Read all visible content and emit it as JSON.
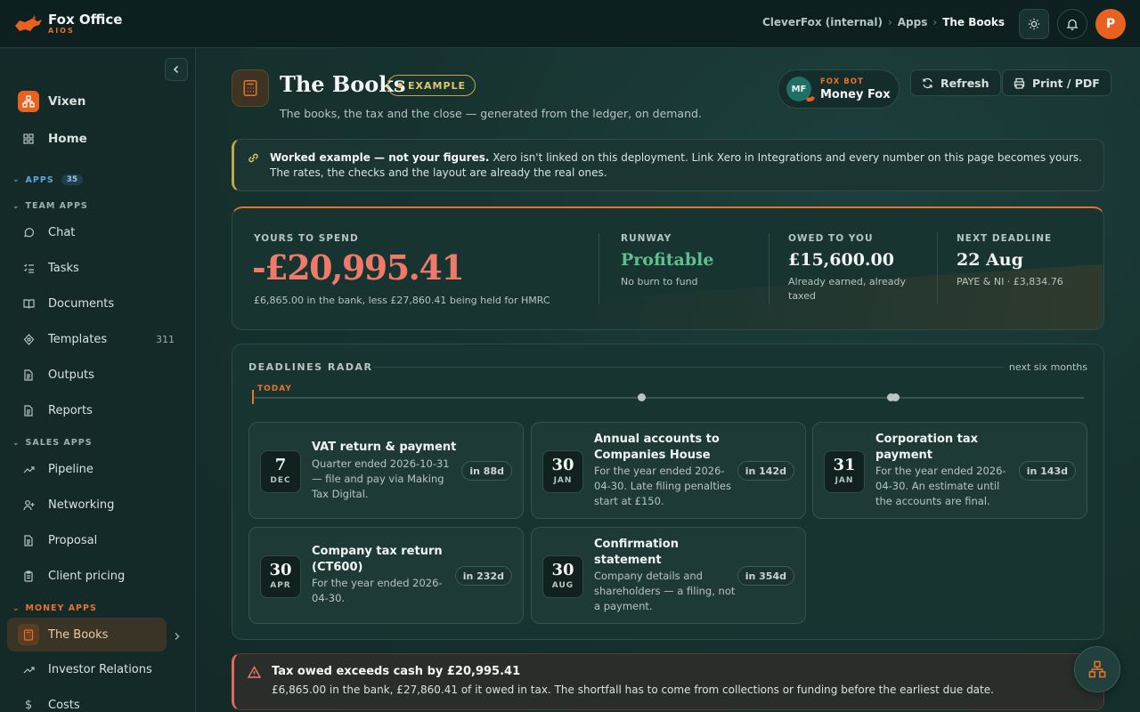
{
  "brand": {
    "name": "Fox Office",
    "sub": "AIOS"
  },
  "breadcrumb": [
    "CleverFox (internal)",
    "Apps",
    "The Books"
  ],
  "user": {
    "initial": "P"
  },
  "sidebar": {
    "top": [
      {
        "label": "Vixen",
        "icon": "org-icon"
      },
      {
        "label": "Home",
        "icon": "grid-icon"
      }
    ],
    "apps_label": "APPS",
    "apps_count": "35",
    "team_label": "TEAM APPS",
    "team": [
      {
        "label": "Chat",
        "icon": "chat-icon"
      },
      {
        "label": "Tasks",
        "icon": "tasks-icon"
      },
      {
        "label": "Documents",
        "icon": "book-icon"
      },
      {
        "label": "Templates",
        "icon": "template-icon",
        "count": "311"
      },
      {
        "label": "Outputs",
        "icon": "doc-icon"
      },
      {
        "label": "Reports",
        "icon": "doc-icon"
      }
    ],
    "sales_label": "SALES APPS",
    "sales": [
      {
        "label": "Pipeline",
        "icon": "trend-icon"
      },
      {
        "label": "Networking",
        "icon": "person-add-icon"
      },
      {
        "label": "Proposal",
        "icon": "doc-icon"
      },
      {
        "label": "Client pricing",
        "icon": "clipboard-icon"
      }
    ],
    "money_label": "MONEY APPS",
    "money": [
      {
        "label": "The Books",
        "icon": "calculator-icon"
      },
      {
        "label": "Investor Relations",
        "icon": "trend-icon"
      },
      {
        "label": "Costs",
        "icon": "dollar-icon"
      }
    ]
  },
  "header": {
    "title": "The Books",
    "badge": "EXAMPLE",
    "subtitle": "The books, the tax and the close — generated from the ledger, on demand.",
    "bot_initials": "MF",
    "bot_kicker": "FOX BOT",
    "bot_name": "Money Fox",
    "refresh_label": "Refresh",
    "print_label": "Print / PDF"
  },
  "notice": {
    "bold": "Worked example — not your figures.",
    "text": " Xero isn't linked on this deployment. Link Xero in Integrations and every number on this page becomes yours. The rates, the checks and the layout are already the real ones."
  },
  "stats": {
    "spend_label": "YOURS TO SPEND",
    "spend_value": "-£20,995.41",
    "spend_note": "£6,865.00 in the bank, less £27,860.41 being held for HMRC",
    "runway_label": "RUNWAY",
    "runway_value": "Profitable",
    "runway_note": "No burn to fund",
    "owed_label": "OWED TO YOU",
    "owed_value": "£15,600.00",
    "owed_note": "Already earned, already taxed",
    "deadline_label": "NEXT DEADLINE",
    "deadline_value": "22 Aug",
    "deadline_note": "PAYE & NI · £3,834.76"
  },
  "radar": {
    "title": "DEADLINES RADAR",
    "range": "next six months",
    "today": "TODAY",
    "items": [
      {
        "day": "7",
        "month": "DEC",
        "title": "VAT return & payment",
        "desc": "Quarter ended 2026-10-31 — file and pay via Making Tax Digital.",
        "due": "in 88d"
      },
      {
        "day": "30",
        "month": "JAN",
        "title": "Annual accounts to Companies House",
        "desc": "For the year ended 2026-04-30. Late filing penalties start at £150.",
        "due": "in 142d"
      },
      {
        "day": "31",
        "month": "JAN",
        "title": "Corporation tax payment",
        "desc": "For the year ended 2026-04-30. An estimate until the accounts are final.",
        "due": "in 143d"
      },
      {
        "day": "30",
        "month": "APR",
        "title": "Company tax return (CT600)",
        "desc": "For the year ended 2026-04-30.",
        "due": "in 232d"
      },
      {
        "day": "30",
        "month": "AUG",
        "title": "Confirmation statement",
        "desc": "Company details and shareholders — a filing, not a payment.",
        "due": "in 354d"
      }
    ]
  },
  "alert": {
    "head": "Tax owed exceeds cash by £20,995.41",
    "body": "£6,865.00 in the bank, £27,860.41 of it owed in tax. The shortfall has to come from collections or funding before the earliest due date."
  },
  "colors": {
    "accent": "#e8722a",
    "negative": "#ef7a6a",
    "positive": "#5fbf8e",
    "warning": "#c9a54a"
  }
}
